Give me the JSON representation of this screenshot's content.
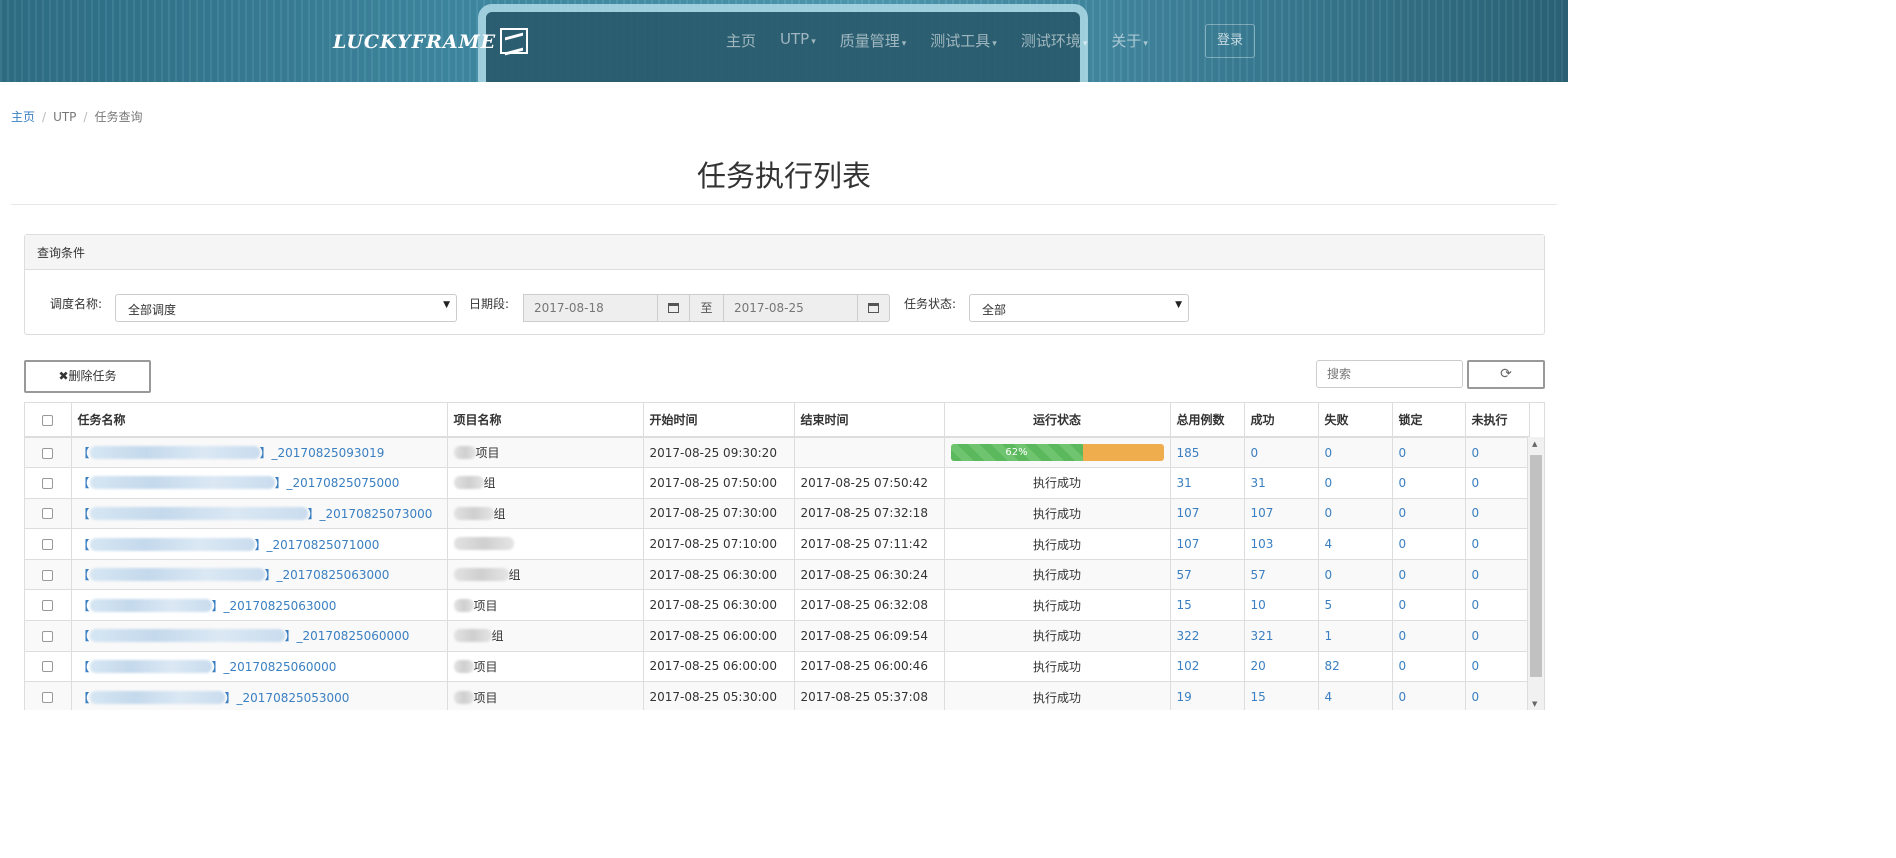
{
  "header": {
    "logo_text": "LUCKYFRAME",
    "nav": [
      {
        "label": "主页",
        "caret": false
      },
      {
        "label": "UTP",
        "caret": true
      },
      {
        "label": "质量管理",
        "caret": true
      },
      {
        "label": "测试工具",
        "caret": true
      },
      {
        "label": "测试环境",
        "caret": true
      },
      {
        "label": "关于",
        "caret": true
      }
    ],
    "login_label": "登录"
  },
  "breadcrumb": {
    "home": "主页",
    "section": "UTP",
    "current": "任务查询"
  },
  "page_title": "任务执行列表",
  "query": {
    "panel_title": "查询条件",
    "schedule_label": "调度名称:",
    "schedule_value": "全部调度",
    "date_label": "日期段:",
    "date_from": "2017-08-18",
    "date_sep": "至",
    "date_to": "2017-08-25",
    "status_label": "任务状态:",
    "status_value": "全部"
  },
  "toolbar": {
    "delete_label": "删除任务",
    "search_placeholder": "搜索"
  },
  "table": {
    "headers": [
      "任务名称",
      "项目名称",
      "开始时间",
      "结束时间",
      "运行状态",
      "总用例数",
      "成功",
      "失败",
      "锁定",
      "未执行"
    ],
    "rows": [
      {
        "task": "_20170825093019",
        "project": "项目",
        "start": "2017-08-25 09:30:20",
        "end": "",
        "status": "",
        "progress": 62,
        "progress_label": "62%",
        "total": "185",
        "success": "0",
        "fail": "0",
        "lock": "0",
        "pending": "0"
      },
      {
        "task": "_20170825075000",
        "project": "组",
        "start": "2017-08-25 07:50:00",
        "end": "2017-08-25 07:50:42",
        "status": "执行成功",
        "total": "31",
        "success": "31",
        "fail": "0",
        "lock": "0",
        "pending": "0"
      },
      {
        "task": "_20170825073000",
        "project": "组",
        "start": "2017-08-25 07:30:00",
        "end": "2017-08-25 07:32:18",
        "status": "执行成功",
        "total": "107",
        "success": "107",
        "fail": "0",
        "lock": "0",
        "pending": "0"
      },
      {
        "task": "_20170825071000",
        "project": "",
        "start": "2017-08-25 07:10:00",
        "end": "2017-08-25 07:11:42",
        "status": "执行成功",
        "total": "107",
        "success": "103",
        "fail": "4",
        "lock": "0",
        "pending": "0"
      },
      {
        "task": "_20170825063000",
        "project": "组",
        "start": "2017-08-25 06:30:00",
        "end": "2017-08-25 06:30:24",
        "status": "执行成功",
        "total": "57",
        "success": "57",
        "fail": "0",
        "lock": "0",
        "pending": "0"
      },
      {
        "task": "_20170825063000",
        "project": "项目",
        "start": "2017-08-25 06:30:00",
        "end": "2017-08-25 06:32:08",
        "status": "执行成功",
        "total": "15",
        "success": "10",
        "fail": "5",
        "lock": "0",
        "pending": "0"
      },
      {
        "task": "_20170825060000",
        "project": "组",
        "start": "2017-08-25 06:00:00",
        "end": "2017-08-25 06:09:54",
        "status": "执行成功",
        "total": "322",
        "success": "321",
        "fail": "1",
        "lock": "0",
        "pending": "0"
      },
      {
        "task": "_20170825060000",
        "project": "项目",
        "start": "2017-08-25 06:00:00",
        "end": "2017-08-25 06:00:46",
        "status": "执行成功",
        "total": "102",
        "success": "20",
        "fail": "82",
        "lock": "0",
        "pending": "0"
      },
      {
        "task": "_20170825053000",
        "project": "项目",
        "start": "2017-08-25 05:30:00",
        "end": "2017-08-25 05:37:08",
        "status": "执行成功",
        "total": "19",
        "success": "15",
        "fail": "4",
        "lock": "0",
        "pending": "0"
      }
    ]
  }
}
